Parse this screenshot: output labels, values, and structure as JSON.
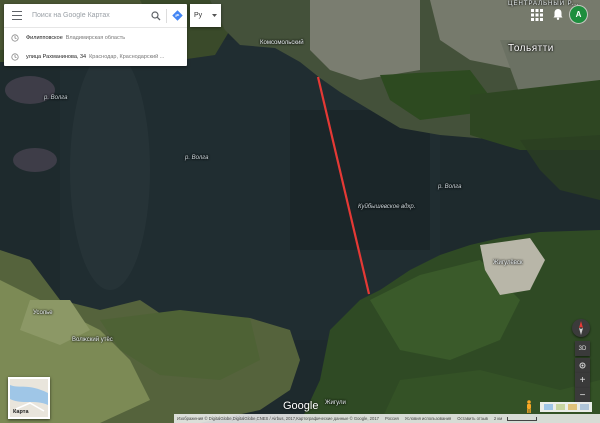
{
  "search": {
    "placeholder": "Поиск на Google Картах"
  },
  "suggestions": [
    {
      "name": "Филипповское",
      "detail": "Владимирская область"
    },
    {
      "name": "улица Рахманинова, 34",
      "detail": "Краснодар, Краснодарский ..."
    }
  ],
  "language": {
    "selected": "Ру"
  },
  "account": {
    "initial": "A"
  },
  "map_labels": {
    "volga_left": "р. Волга",
    "volga_center": "р. Волга",
    "volga_right": "р. Волга",
    "reservoir": "Куйбышевское вдхр.",
    "city": "Тольятти",
    "district": "ЦЕНТРАЛЬНЫЙ Р...",
    "komsomolsky": "Комсомольский",
    "usolye": "Усолье",
    "volzhsky": "Волжский утёс",
    "zhiguli": "Жигули",
    "zhigulevsk": "Жигулёвск"
  },
  "layer_switch": {
    "label": "Карта"
  },
  "controls": {
    "three_d": "3D",
    "plus": "+",
    "minus": "−"
  },
  "logo": "Google",
  "footer": {
    "attribution": "Изображения © DigitalGlobe,DigitalGlobe,CNES / Airbus, 2017,Картографические данные © Google, 2017",
    "region": "Россия",
    "terms": "Условия использования",
    "feedback": "Оставить отзыв",
    "scale": "2 км"
  },
  "colors": {
    "route": "#e53935",
    "water": "#1e2a2d",
    "forest": "#2f4a24",
    "avatar": "#1e8e3e",
    "directions": "#4285f4"
  }
}
